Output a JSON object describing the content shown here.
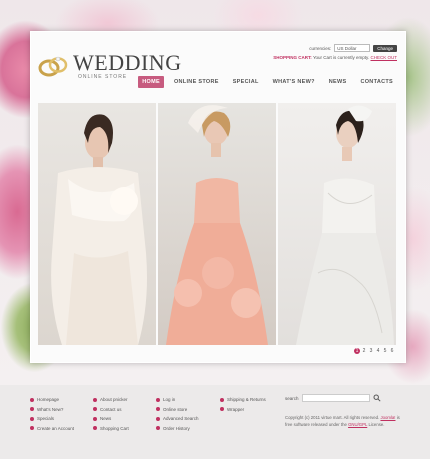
{
  "header": {
    "brand": "WEDDING",
    "tagline": "ONLINE STORE",
    "currency_label": "currencies:",
    "currency_value": "US Dollar",
    "currency_button": "Change",
    "cart_label": "SHOPPING CART:",
    "cart_text": "Your Cart is currently empty.",
    "cart_link": "CHECK OUT"
  },
  "nav": {
    "items": [
      "HOME",
      "ONLINE STORE",
      "SPECIAL",
      "WHAT'S NEW?",
      "NEWS",
      "CONTACTS"
    ]
  },
  "gallery": {
    "pages": [
      "1",
      "2",
      "3",
      "4",
      "5",
      "6"
    ],
    "active_page": "1"
  },
  "footer": {
    "col1": [
      "Homepage",
      "What's New?",
      "Specials",
      "Create an Account"
    ],
    "col2": [
      "About pnicker",
      "Contact us",
      "News",
      "Shopping Cart"
    ],
    "col3": [
      "Log in",
      "Online store",
      "Advanced Search",
      "Order History"
    ],
    "col4": [
      "Shipping & Returns",
      "Wrapper"
    ],
    "search_label": "search",
    "copyright": "Copyright (c) 2011 virtue mart. All rights reserved. ",
    "copyright_link1": "Joomla!",
    "copyright_mid": " is free software released under the ",
    "copyright_link2": "GNU/GPL",
    "copyright_end": " License."
  },
  "colors": {
    "accent": "#c03060",
    "nav_active": "#c75b7f"
  }
}
